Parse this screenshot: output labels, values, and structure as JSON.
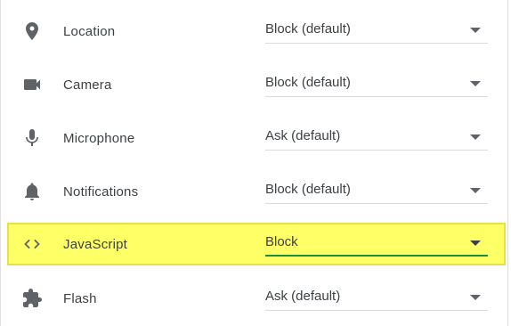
{
  "rows": [
    {
      "label": "Location",
      "icon": "location-pin-icon",
      "value": "Block (default)"
    },
    {
      "label": "Camera",
      "icon": "camera-icon",
      "value": "Block (default)"
    },
    {
      "label": "Microphone",
      "icon": "microphone-icon",
      "value": "Ask (default)"
    },
    {
      "label": "Notifications",
      "icon": "bell-icon",
      "value": "Block (default)"
    },
    {
      "label": "JavaScript",
      "icon": "code-brackets-icon",
      "value": "Block",
      "highlighted": true
    },
    {
      "label": "Flash",
      "icon": "puzzle-piece-icon",
      "value": "Ask (default)"
    }
  ],
  "colors": {
    "highlight": "#ffff66",
    "highlight_border": "#e8e04a",
    "focused_underline": "#1e8e3e",
    "icon": "#5f6368",
    "text": "#3c4043"
  }
}
